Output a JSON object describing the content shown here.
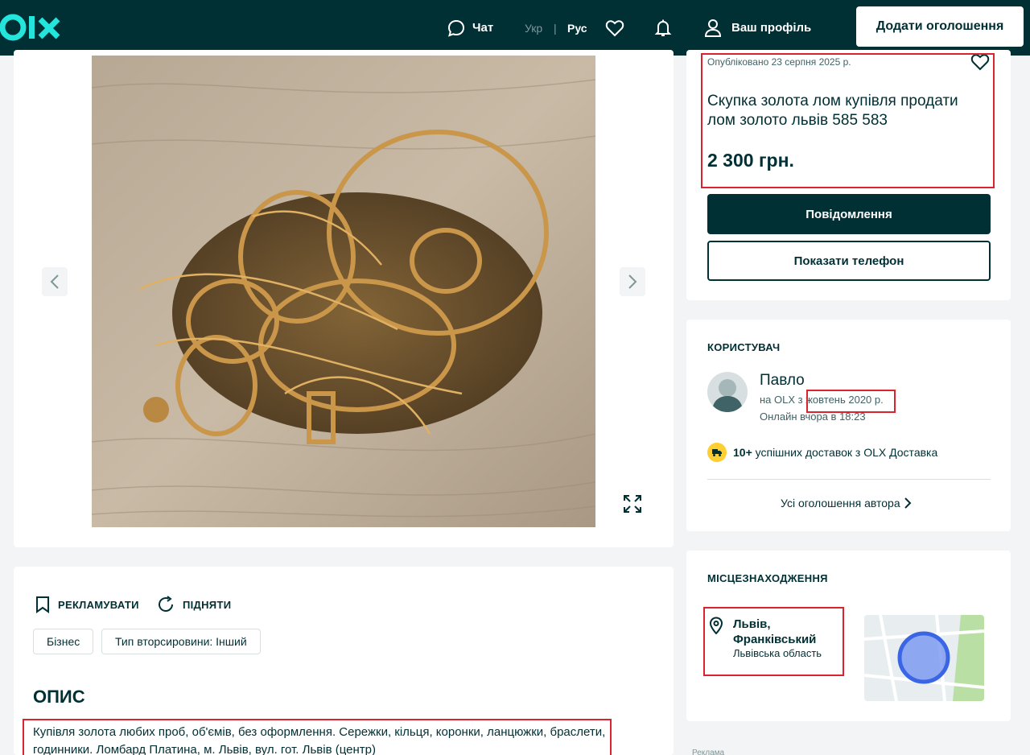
{
  "header": {
    "logo_text": "olx",
    "chat": "Чат",
    "lang_ukr": "Укр",
    "lang_sep": "|",
    "lang_rus": "Рус",
    "profile": "Ваш профіль",
    "add_ad": "Додати оголошення"
  },
  "ad": {
    "posted": "Опубліковано 23 серпня 2025 р.",
    "title": "Скупка золота лом купівля продати лом золото львів 585 583",
    "price": "2 300 грн.",
    "message_button": "Повідомлення",
    "phone_button": "Показати телефон"
  },
  "user": {
    "heading": "КОРИСТУВАЧ",
    "name": "Павло",
    "since": "на OLX з жовтень 2020 р.",
    "online": "Онлайн вчора в 18:23",
    "delivery_count": "10+",
    "delivery_text": "успішних доставок з OLX Доставка",
    "all_ads": "Усі оголошення автора"
  },
  "location": {
    "heading": "МІСЦЕЗНАХОДЖЕННЯ",
    "city": "Львів, Франківський",
    "region": "Львівська область"
  },
  "ads_label": "Реклама",
  "description": {
    "promote": "РЕКЛАМУВАТИ",
    "raise": "ПІДНЯТИ",
    "tag_business": "Бізнес",
    "tag_type": "Тип вторсировини: Інший",
    "heading": "ОПИС",
    "text": "Купівля золота любих проб, об'ємів, без оформлення. Сережки, кільця, коронки, ланцюжки, браслети, годинники. Ломбард Платина, м. Львів, вул. гот. Львів (центр)"
  },
  "colors": {
    "brand_dark": "#002f34",
    "accent_teal": "#23e5db",
    "highlight_red": "#d9232d",
    "delivery_yellow": "#ffce32"
  }
}
